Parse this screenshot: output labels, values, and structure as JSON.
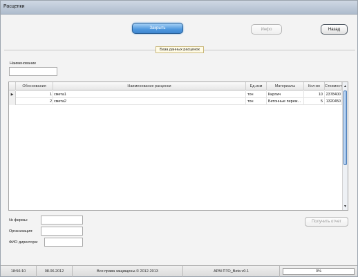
{
  "window": {
    "title": "Расценки"
  },
  "toolbar": {
    "close_label": "Закрыть",
    "info_label": "Инфо",
    "back_label": "Назад"
  },
  "group_label": "База данных расценок",
  "filter": {
    "name_label": "Наименование",
    "name_value": ""
  },
  "table": {
    "headers": [
      "Обоснования",
      "Наименование расценки",
      "Ед.изм",
      "Материалы",
      "Кол-во",
      "Стоимость"
    ],
    "rows": [
      {
        "marker": "▶",
        "num": "1",
        "name": "смета1",
        "unit": "тон",
        "material": "Кирпич",
        "qty": "10",
        "cost": "2378400"
      },
      {
        "marker": "",
        "num": "2",
        "name": "смета2",
        "unit": "тон",
        "material": "Бетонные переж...",
        "qty": "5",
        "cost": "1320450"
      }
    ]
  },
  "form": {
    "firm_label": "№ фирмы:",
    "org_label": "Организация:",
    "director_label": "ФИО директора:",
    "firm_value": "",
    "org_value": "",
    "director_value": ""
  },
  "report_button_label": "Получить отчет",
  "status": {
    "time": "18:56:10",
    "date": "08.06.2012",
    "copyright": "Все права защищены.© 2012-2013",
    "app": "АРМ ПТО_Beta v0.1",
    "progress_text": "0%",
    "progress": 0
  }
}
